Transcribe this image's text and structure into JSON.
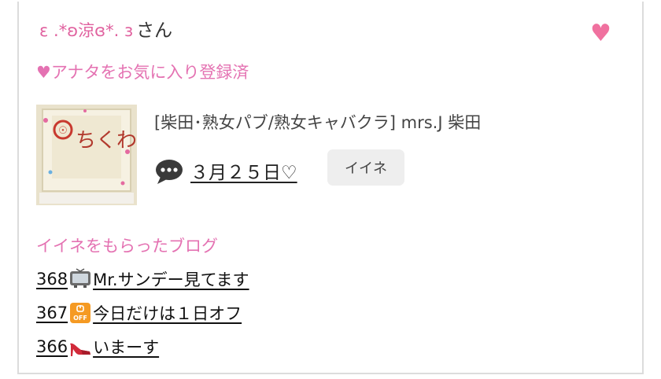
{
  "user": {
    "nickname": "ε .*ʚ涼ɞ*. ɜ",
    "honorific": "さん"
  },
  "favorite_status": "♥アナタをお気に入り登録済",
  "post": {
    "shop_name": "[柴田･熟女パブ/熟女キャバクラ]  mrs.J 柴田",
    "date_label": "３月２５日♡",
    "like_button": "イイネ",
    "thumbnail_text": "ちくわ"
  },
  "liked_blogs": {
    "heading": "イイネをもらったブログ",
    "items": [
      {
        "number": "368",
        "icon": "tv-icon",
        "title": "Mr.サンデー見てます"
      },
      {
        "number": "367",
        "icon": "off-icon",
        "title": "今日だけは１日オフ"
      },
      {
        "number": "366",
        "icon": "high-heel-icon",
        "title": "いまーす"
      }
    ]
  },
  "colors": {
    "accent_pink": "#e472b2",
    "heart": "#f0719f",
    "button_bg": "#eeeeee"
  }
}
